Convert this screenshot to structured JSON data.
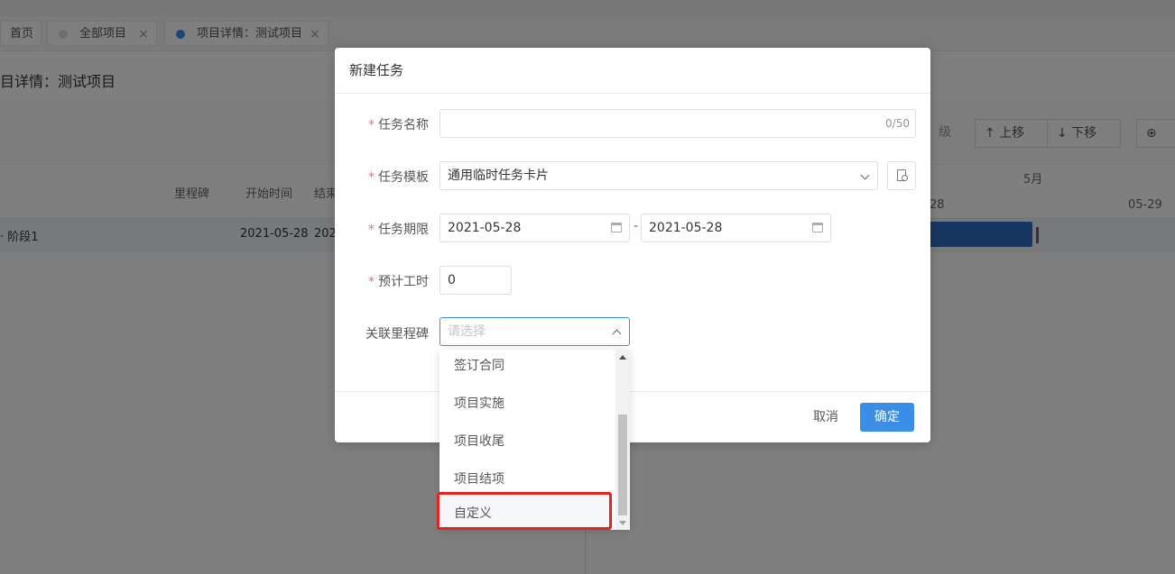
{
  "tabs": [
    {
      "label": "首页"
    },
    {
      "label": "全部项目"
    },
    {
      "label": "项目详情：测试项目"
    }
  ],
  "page_title": "目详情：测试项目",
  "toolbar": {
    "level_fragment": "级",
    "move_up": "上移",
    "move_down": "下移"
  },
  "grid": {
    "columns": [
      "里程碑",
      "开始时间",
      "结束"
    ],
    "row": {
      "name": "阶段1",
      "start": "2021-05-28",
      "end_fragment": "202"
    },
    "gantt": {
      "month": "5月",
      "day_left": "28",
      "day_right": "05-29"
    }
  },
  "dialog": {
    "title": "新建任务",
    "fields": {
      "task_name": {
        "label": "任务名称",
        "value": "",
        "counter": "0/50"
      },
      "template": {
        "label": "任务模板",
        "value": "通用临时任务卡片"
      },
      "period": {
        "label": "任务期限",
        "start": "2021-05-28",
        "separator": "-",
        "end": "2021-05-28"
      },
      "hours": {
        "label": "预计工时",
        "value": "0"
      },
      "milestone": {
        "label": "关联里程碑",
        "placeholder": "请选择"
      }
    },
    "cancel_label": "取消",
    "ok_label": "确定"
  },
  "dropdown": {
    "options": [
      "签订合同",
      "项目实施",
      "项目收尾",
      "项目结项",
      "自定义"
    ],
    "highlighted": "自定义"
  },
  "colors": {
    "primary": "#3a8ee6",
    "required": "#f56c6c",
    "highlight_box": "#e5231d",
    "gantt_bar": "#2e6dc2"
  }
}
